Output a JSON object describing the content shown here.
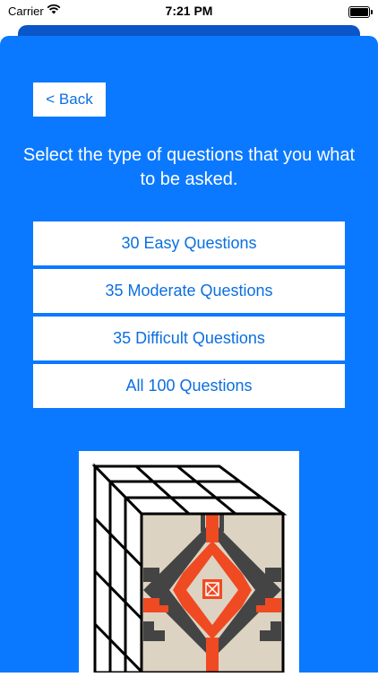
{
  "status_bar": {
    "carrier": "Carrier",
    "time": "7:21 PM"
  },
  "navigation": {
    "back_label": "< Back"
  },
  "prompt": "Select the type of questions that you what to be asked.",
  "options": [
    {
      "label": "30 Easy Questions"
    },
    {
      "label": "35 Moderate Questions"
    },
    {
      "label": "35 Difficult Questions"
    },
    {
      "label": "All 100 Questions"
    }
  ],
  "colors": {
    "background": "#0b79ff",
    "button_text": "#0b6fe0",
    "pattern_red": "#f04a22",
    "pattern_gray": "#444444",
    "pattern_tan": "#ddd3c2"
  },
  "illustration": {
    "icon": "rubiks-cube-navajo-pattern-icon"
  }
}
